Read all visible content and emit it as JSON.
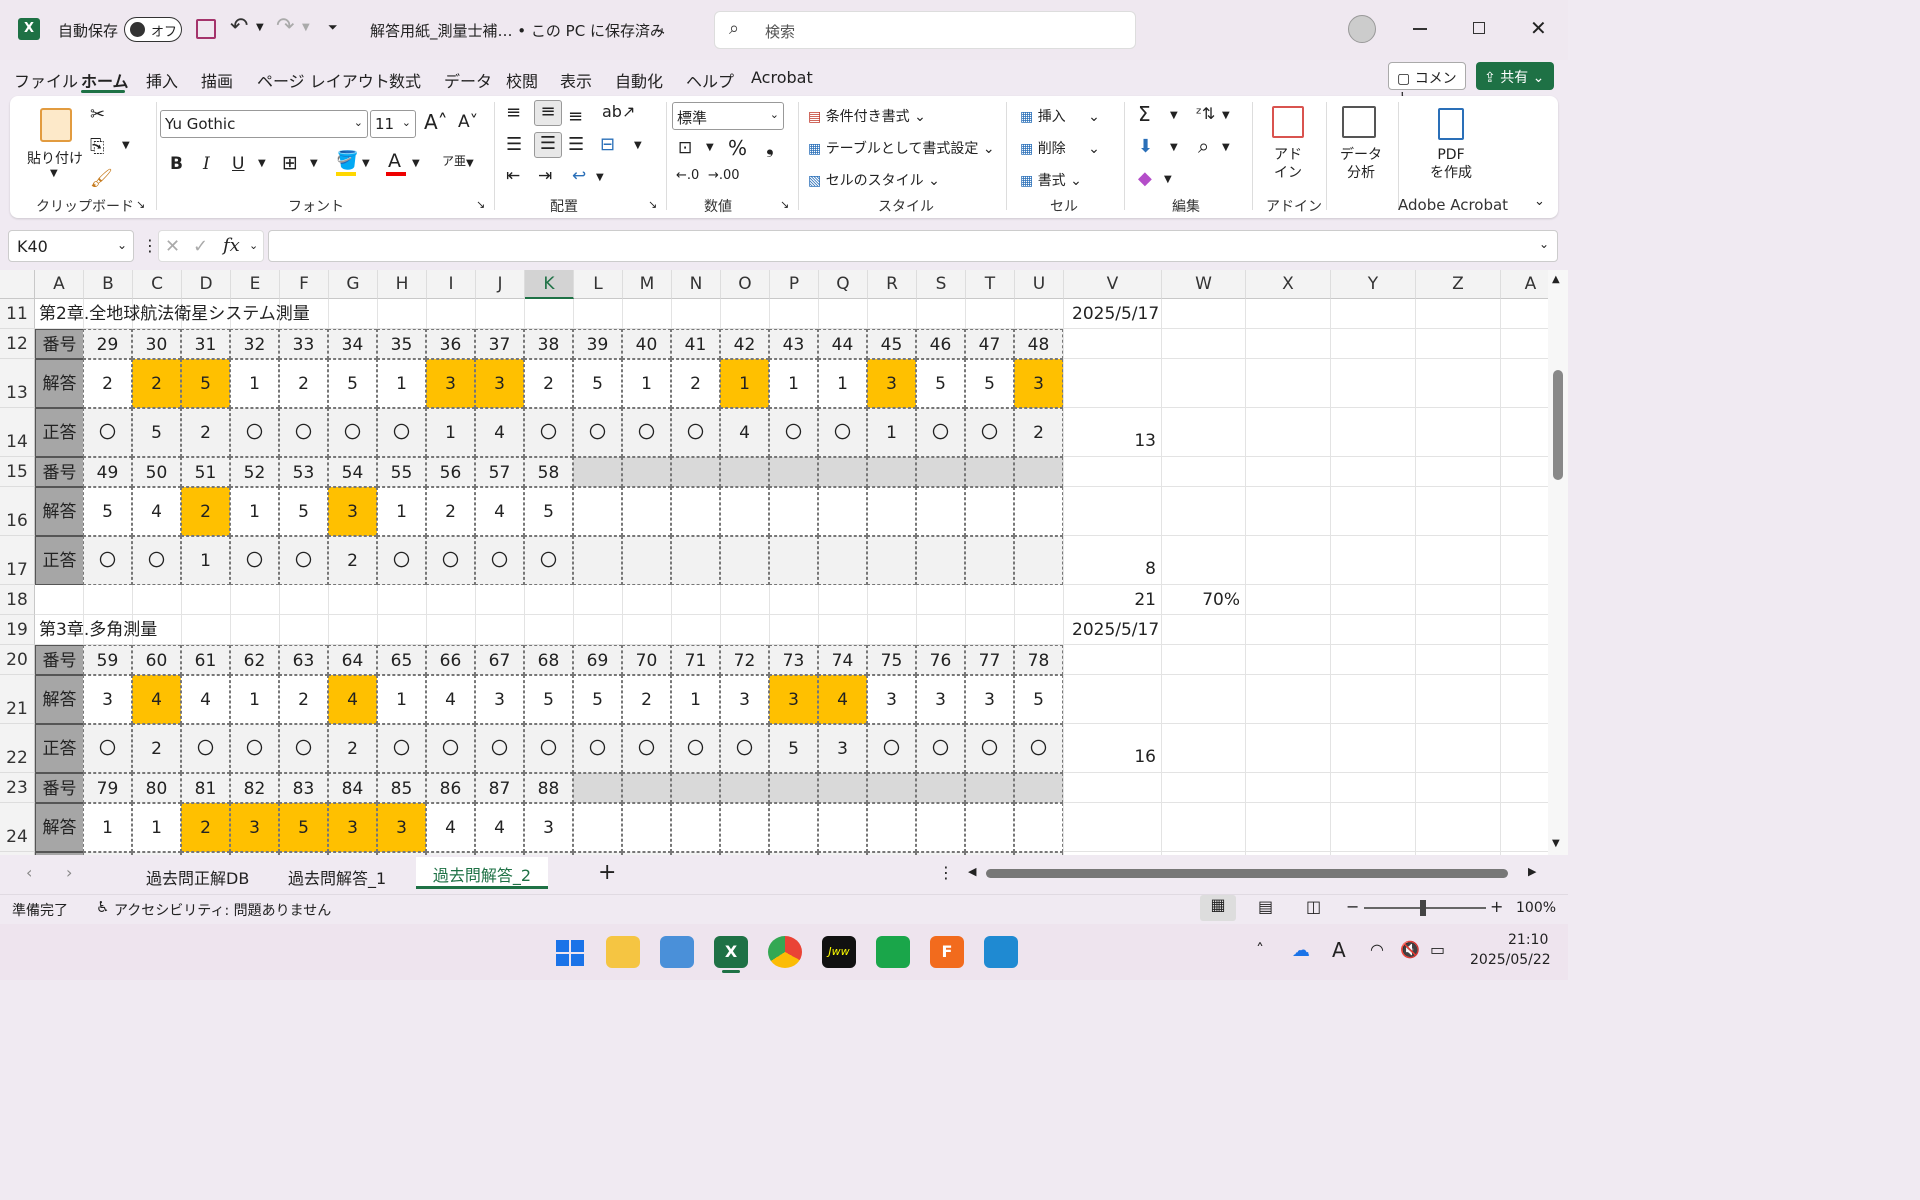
{
  "titlebar": {
    "autosave_label": "自動保存",
    "autosave_toggle": "オフ",
    "doc_title": "解答用紙_測量士補… • この PC に保存済み",
    "search_placeholder": "検索"
  },
  "menu": [
    "ファイル",
    "ホーム",
    "挿入",
    "描画",
    "ページ レイアウト",
    "数式",
    "データ",
    "校閲",
    "表示",
    "自動化",
    "ヘルプ",
    "Acrobat"
  ],
  "actions": {
    "comment": "コメント",
    "share": "共有"
  },
  "ribbon": {
    "paste": "貼り付け",
    "font_name": "Yu Gothic",
    "font_size": "11",
    "number_format": "標準",
    "cond_format": "条件付き書式",
    "table_format": "テーブルとして書式設定",
    "cell_style": "セルのスタイル",
    "insert": "挿入",
    "delete": "削除",
    "format": "書式",
    "addin": "アド\nイン",
    "data_analysis": "データ\n分析",
    "pdf": "PDF\nを作成",
    "groups": [
      "クリップボード",
      "フォント",
      "配置",
      "数値",
      "スタイル",
      "セル",
      "編集",
      "アドイン",
      "Adobe Acrobat"
    ]
  },
  "formula": {
    "name_box": "K40",
    "content": ""
  },
  "columns": [
    "A",
    "B",
    "C",
    "D",
    "E",
    "F",
    "G",
    "H",
    "I",
    "J",
    "K",
    "L",
    "M",
    "N",
    "O",
    "P",
    "Q",
    "R",
    "S",
    "T",
    "U",
    "V",
    "W",
    "X",
    "Y",
    "Z",
    "A"
  ],
  "rows": {
    "r11": {
      "num": "11",
      "title": "第2章.全地球航法衛星システム測量",
      "date": "2025/5/17"
    },
    "r12": {
      "num": "12",
      "label": "番号",
      "cells": [
        "29",
        "30",
        "31",
        "32",
        "33",
        "34",
        "35",
        "36",
        "37",
        "38",
        "39",
        "40",
        "41",
        "42",
        "43",
        "44",
        "45",
        "46",
        "47",
        "48"
      ]
    },
    "r13": {
      "num": "13",
      "label": "解答",
      "cells": [
        "2",
        "2",
        "5",
        "1",
        "2",
        "5",
        "1",
        "3",
        "3",
        "2",
        "5",
        "1",
        "2",
        "1",
        "1",
        "1",
        "3",
        "5",
        "5",
        "3"
      ],
      "hl": [
        1,
        2,
        7,
        8,
        13,
        16,
        19
      ]
    },
    "r14": {
      "num": "14",
      "label": "正答",
      "cells": [
        "〇",
        "5",
        "2",
        "〇",
        "〇",
        "〇",
        "〇",
        "1",
        "4",
        "〇",
        "〇",
        "〇",
        "〇",
        "4",
        "〇",
        "〇",
        "1",
        "〇",
        "〇",
        "2"
      ],
      "v": "13"
    },
    "r15": {
      "num": "15",
      "label": "番号",
      "cells": [
        "49",
        "50",
        "51",
        "52",
        "53",
        "54",
        "55",
        "56",
        "57",
        "58",
        "",
        "",
        "",
        "",
        "",
        "",
        "",
        "",
        "",
        ""
      ]
    },
    "r16": {
      "num": "16",
      "label": "解答",
      "cells": [
        "5",
        "4",
        "2",
        "1",
        "5",
        "3",
        "1",
        "2",
        "4",
        "5",
        "",
        "",
        "",
        "",
        "",
        "",
        "",
        "",
        "",
        ""
      ],
      "hl": [
        2,
        5
      ]
    },
    "r17": {
      "num": "17",
      "label": "正答",
      "cells": [
        "〇",
        "〇",
        "1",
        "〇",
        "〇",
        "2",
        "〇",
        "〇",
        "〇",
        "〇",
        "",
        "",
        "",
        "",
        "",
        "",
        "",
        "",
        "",
        ""
      ],
      "v": "8"
    },
    "r18": {
      "num": "18",
      "v": "21",
      "w": "70%"
    },
    "r19": {
      "num": "19",
      "title": "第3章.多角測量",
      "date": "2025/5/17"
    },
    "r20": {
      "num": "20",
      "label": "番号",
      "cells": [
        "59",
        "60",
        "61",
        "62",
        "63",
        "64",
        "65",
        "66",
        "67",
        "68",
        "69",
        "70",
        "71",
        "72",
        "73",
        "74",
        "75",
        "76",
        "77",
        "78"
      ]
    },
    "r21": {
      "num": "21",
      "label": "解答",
      "cells": [
        "3",
        "4",
        "4",
        "1",
        "2",
        "4",
        "1",
        "4",
        "3",
        "5",
        "5",
        "2",
        "1",
        "3",
        "3",
        "4",
        "3",
        "3",
        "3",
        "5"
      ],
      "hl": [
        1,
        5,
        14,
        15
      ]
    },
    "r22": {
      "num": "22",
      "label": "正答",
      "cells": [
        "〇",
        "2",
        "〇",
        "〇",
        "〇",
        "2",
        "〇",
        "〇",
        "〇",
        "〇",
        "〇",
        "〇",
        "〇",
        "〇",
        "5",
        "3",
        "〇",
        "〇",
        "〇",
        "〇"
      ],
      "v": "16"
    },
    "r23": {
      "num": "23",
      "label": "番号",
      "cells": [
        "79",
        "80",
        "81",
        "82",
        "83",
        "84",
        "85",
        "86",
        "87",
        "88",
        "",
        "",
        "",
        "",
        "",
        "",
        "",
        "",
        "",
        ""
      ]
    },
    "r24": {
      "num": "24",
      "label": "解答",
      "cells": [
        "1",
        "1",
        "2",
        "3",
        "5",
        "3",
        "3",
        "4",
        "4",
        "3",
        "",
        "",
        "",
        "",
        "",
        "",
        "",
        "",
        "",
        ""
      ],
      "hl": [
        2,
        3,
        4,
        5,
        6
      ]
    }
  },
  "sheets": [
    "過去問正解DB",
    "過去問解答_1",
    "過去問解答_2"
  ],
  "status": {
    "ready": "準備完了",
    "accessibility": "アクセシビリティ: 問題ありません",
    "zoom": "100%"
  },
  "clock": {
    "time": "21:10",
    "date": "2025/05/22"
  },
  "colors": {
    "highlight": "#ffc000",
    "label_bg": "#a6a6a6",
    "blank_bg": "#d9d9d9",
    "excel_green": "#1e7145"
  }
}
